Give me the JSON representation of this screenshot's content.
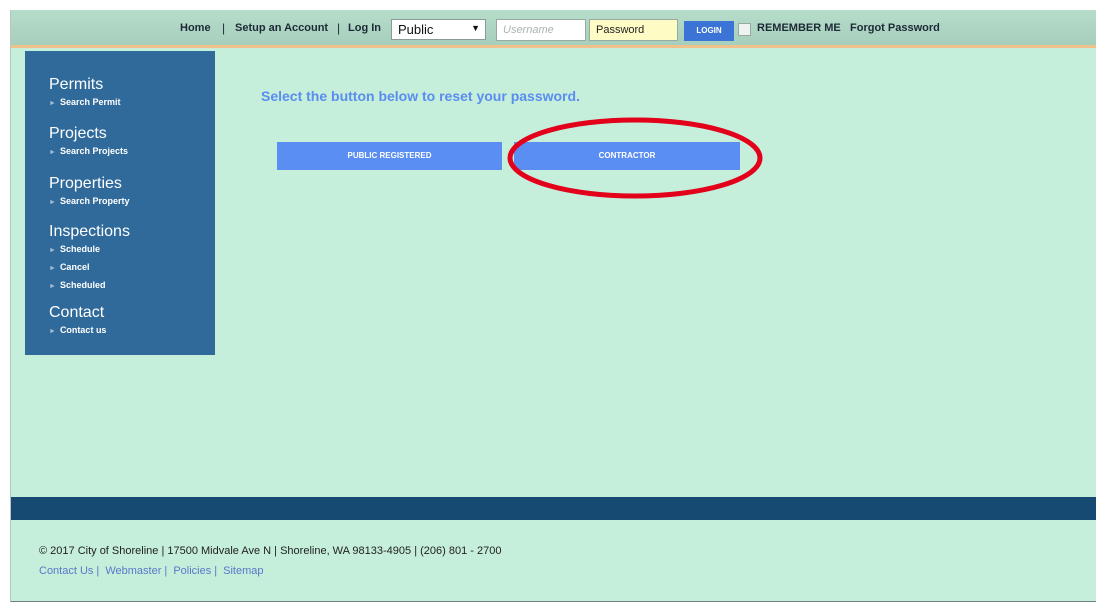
{
  "topbar": {
    "home": "Home",
    "sep": "|",
    "setup_account": "Setup an Account",
    "log_in": "Log In",
    "role_selected": "Public",
    "role_arrow": "▼",
    "username_placeholder": "Username",
    "password_value": "Password",
    "login_button": "LOGIN",
    "remember_me": "REMEMBER ME",
    "forgot_password": "Forgot Password"
  },
  "sidebar": {
    "groups": [
      {
        "title": "Permits",
        "links": [
          "Search Permit"
        ]
      },
      {
        "title": "Projects",
        "links": [
          "Search Projects"
        ]
      },
      {
        "title": "Properties",
        "links": [
          "Search Property"
        ]
      },
      {
        "title": "Inspections",
        "links": [
          "Schedule",
          "Cancel",
          "Scheduled"
        ]
      },
      {
        "title": "Contact",
        "links": [
          "Contact us"
        ]
      }
    ],
    "bullet": "►"
  },
  "main": {
    "heading": "Select the button below to reset your password.",
    "buttons": [
      "PUBLIC REGISTERED",
      "CONTRACTOR"
    ]
  },
  "footer": {
    "info": "© 2017 City of Shoreline | 17500 Midvale Ave N | Shoreline, WA 98133-4905 | (206) 801 - 2700",
    "links": [
      "Contact Us",
      "Webmaster",
      "Policies",
      "Sitemap"
    ],
    "pipe": "|"
  },
  "colors": {
    "background": "#c5eedb",
    "sidebar": "#2f6a9a",
    "accent_button": "#5b8ef2",
    "footer_band": "#164a73",
    "highlight": "#e3001b"
  }
}
